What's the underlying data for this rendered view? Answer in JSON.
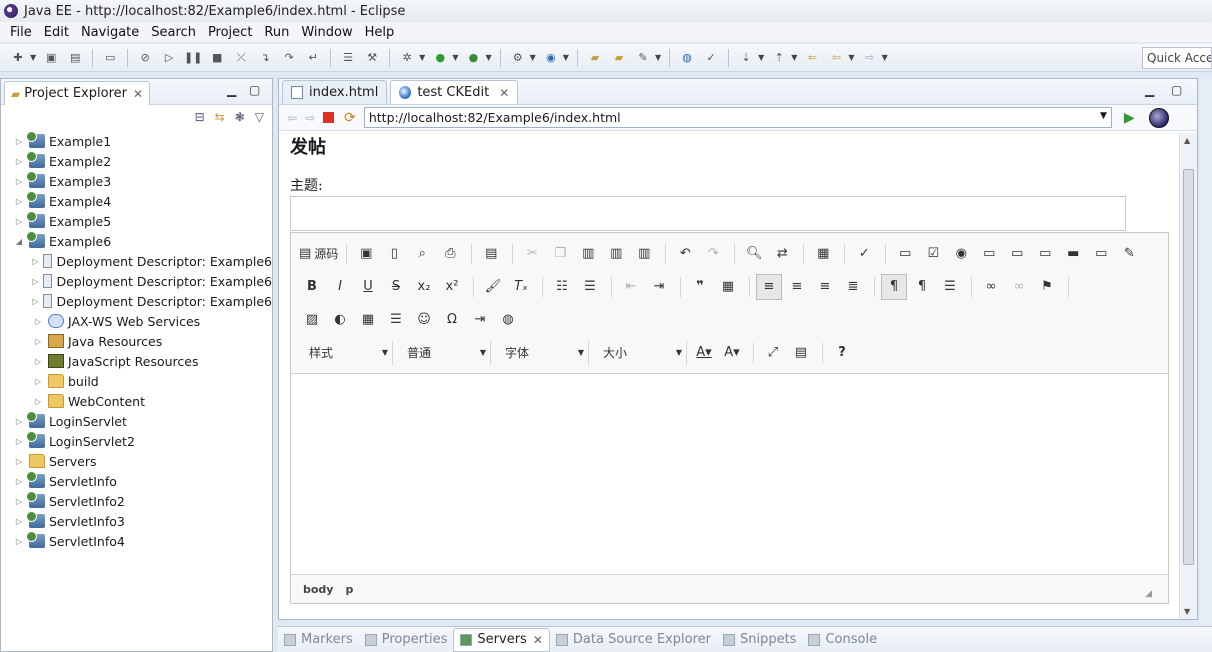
{
  "window": {
    "title": "Java EE - http://localhost:82/Example6/index.html - Eclipse"
  },
  "menu": [
    "File",
    "Edit",
    "Navigate",
    "Search",
    "Project",
    "Run",
    "Window",
    "Help"
  ],
  "toolbar": {
    "quick_access": "Quick Access"
  },
  "explorer": {
    "title": "Project Explorer",
    "tree": [
      {
        "label": "Example1",
        "level": 0,
        "state": "collapsed",
        "icon": "project-icon"
      },
      {
        "label": "Example2",
        "level": 0,
        "state": "collapsed",
        "icon": "project-icon"
      },
      {
        "label": "Example3",
        "level": 0,
        "state": "collapsed",
        "icon": "project-icon"
      },
      {
        "label": "Example4",
        "level": 0,
        "state": "collapsed",
        "icon": "project-icon"
      },
      {
        "label": "Example5",
        "level": 0,
        "state": "collapsed",
        "icon": "project-icon"
      },
      {
        "label": "Example6",
        "level": 0,
        "state": "expanded",
        "icon": "project-icon"
      },
      {
        "label": "Deployment Descriptor: Example6",
        "level": 1,
        "state": "collapsed",
        "icon": "descriptor-icon"
      },
      {
        "label": "Deployment Descriptor: Example6",
        "level": 1,
        "state": "collapsed",
        "icon": "descriptor-icon"
      },
      {
        "label": "Deployment Descriptor: Example6",
        "level": 1,
        "state": "collapsed",
        "icon": "descriptor-icon"
      },
      {
        "label": "JAX-WS Web Services",
        "level": 1,
        "state": "collapsed",
        "icon": "web-services-icon"
      },
      {
        "label": "Java Resources",
        "level": 1,
        "state": "collapsed",
        "icon": "java-resources-icon"
      },
      {
        "label": "JavaScript Resources",
        "level": 1,
        "state": "collapsed",
        "icon": "javascript-resources-icon"
      },
      {
        "label": "build",
        "level": 1,
        "state": "collapsed",
        "icon": "folder-icon"
      },
      {
        "label": "WebContent",
        "level": 1,
        "state": "collapsed",
        "icon": "folder-icon"
      },
      {
        "label": "LoginServlet",
        "level": 0,
        "state": "collapsed",
        "icon": "project-icon"
      },
      {
        "label": "LoginServlet2",
        "level": 0,
        "state": "collapsed",
        "icon": "project-icon"
      },
      {
        "label": "Servers",
        "level": 0,
        "state": "collapsed",
        "icon": "folder-icon"
      },
      {
        "label": "ServletInfo",
        "level": 0,
        "state": "collapsed",
        "icon": "project-icon"
      },
      {
        "label": "ServletInfo2",
        "level": 0,
        "state": "collapsed",
        "icon": "project-icon"
      },
      {
        "label": "ServletInfo3",
        "level": 0,
        "state": "collapsed",
        "icon": "project-icon"
      },
      {
        "label": "ServletInfo4",
        "level": 0,
        "state": "collapsed",
        "icon": "project-icon"
      }
    ]
  },
  "editor": {
    "tabs": [
      {
        "label": "index.html",
        "active": false,
        "icon": "file-icon"
      },
      {
        "label": "test CKEdit",
        "active": true,
        "icon": "globe-icon"
      }
    ],
    "url": "http://localhost:82/Example6/index.html"
  },
  "page": {
    "heading": "发帖",
    "subject_label": "主题:",
    "ckeditor": {
      "source_label": "源码",
      "combos": [
        "样式",
        "普通",
        "字体",
        "大小"
      ],
      "path": [
        "body",
        "p"
      ]
    }
  },
  "bottom_tabs": [
    {
      "label": "Markers",
      "active": false
    },
    {
      "label": "Properties",
      "active": false
    },
    {
      "label": "Servers",
      "active": true
    },
    {
      "label": "Data Source Explorer",
      "active": false
    },
    {
      "label": "Snippets",
      "active": false
    },
    {
      "label": "Console",
      "active": false
    }
  ]
}
